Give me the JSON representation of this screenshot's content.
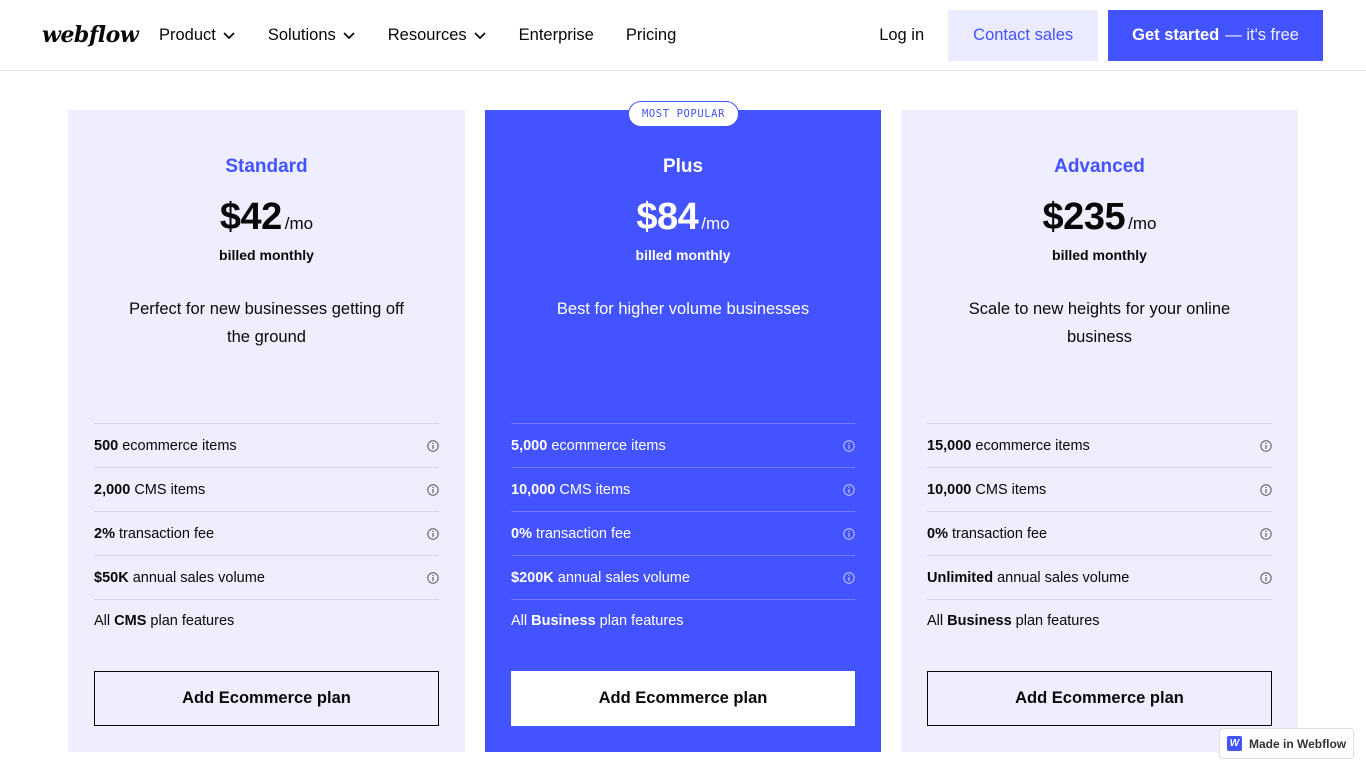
{
  "nav": {
    "logo": "webflow",
    "links": [
      {
        "label": "Product",
        "dropdown": true
      },
      {
        "label": "Solutions",
        "dropdown": true
      },
      {
        "label": "Resources",
        "dropdown": true
      },
      {
        "label": "Enterprise",
        "dropdown": false
      },
      {
        "label": "Pricing",
        "dropdown": false
      }
    ],
    "login": "Log in",
    "contact": "Contact sales",
    "get_started_bold": "Get started",
    "get_started_light": "— it's free"
  },
  "plans": [
    {
      "name": "Standard",
      "price": "$42",
      "period": "/mo",
      "billed": "billed monthly",
      "description": "Perfect for new businesses getting off the ground",
      "features": [
        {
          "value": "500",
          "text": " ecommerce items"
        },
        {
          "value": "2,000",
          "text": " CMS items"
        },
        {
          "value": "2%",
          "text": " transaction fee"
        },
        {
          "value": "$50K",
          "text": " annual sales volume"
        }
      ],
      "all_prefix": "All ",
      "all_plan": "CMS",
      "all_suffix": " plan features",
      "button": "Add Ecommerce plan"
    },
    {
      "name": "Plus",
      "badge": "MOST POPULAR",
      "price": "$84",
      "period": "/mo",
      "billed": "billed monthly",
      "description": "Best for higher volume businesses",
      "features": [
        {
          "value": "5,000",
          "text": " ecommerce items"
        },
        {
          "value": "10,000",
          "text": " CMS items"
        },
        {
          "value": "0%",
          "text": " transaction fee"
        },
        {
          "value": "$200K",
          "text": " annual sales volume"
        }
      ],
      "all_prefix": "All ",
      "all_plan": "Business",
      "all_suffix": " plan features",
      "button": "Add Ecommerce plan"
    },
    {
      "name": "Advanced",
      "price": "$235",
      "period": "/mo",
      "billed": "billed monthly",
      "description": "Scale to new heights for your online business",
      "features": [
        {
          "value": "15,000",
          "text": " ecommerce items"
        },
        {
          "value": "10,000",
          "text": " CMS items"
        },
        {
          "value": "0%",
          "text": " transaction fee"
        },
        {
          "value": "Unlimited",
          "text": " annual sales volume"
        }
      ],
      "all_prefix": "All ",
      "all_plan": "Business",
      "all_suffix": " plan features",
      "button": "Add Ecommerce plan"
    }
  ],
  "made_in": {
    "logo": "W",
    "label": "Made in Webflow"
  },
  "colors": {
    "accent": "#4353ff",
    "card_bg": "#eeeeff",
    "contact_bg": "#ebebff",
    "text": "#080808"
  },
  "icons": {
    "dropdown": "chevron-down-icon",
    "info": "info-icon",
    "badge_logo": "webflow-logo-icon"
  }
}
